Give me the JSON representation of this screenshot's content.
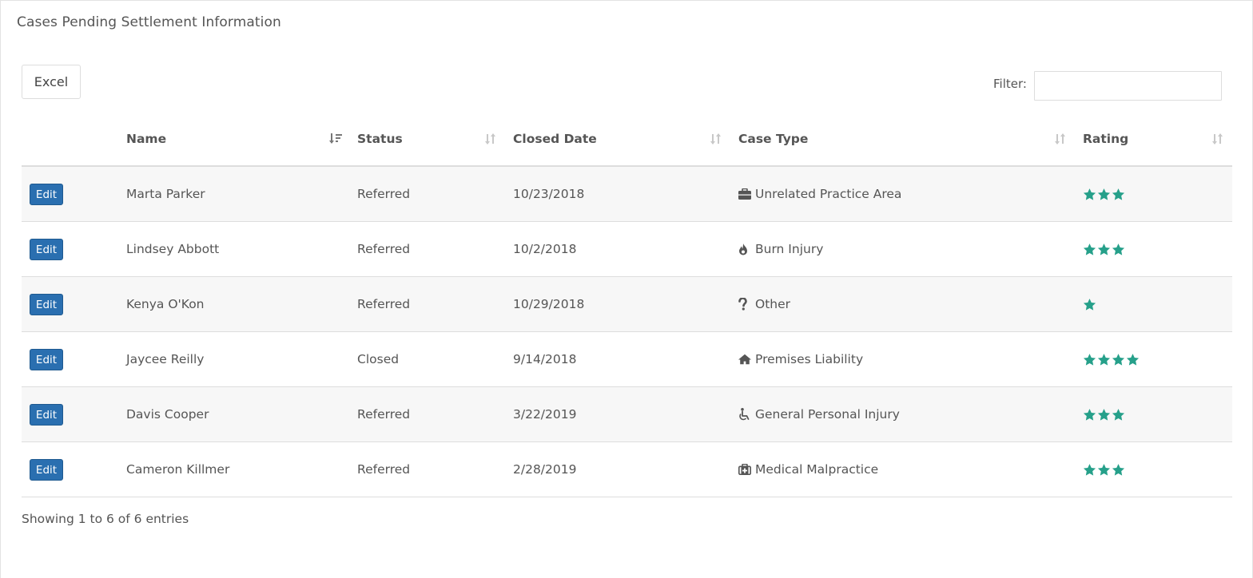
{
  "panel": {
    "title": "Cases Pending Settlement Information"
  },
  "toolbar": {
    "excel_label": "Excel",
    "filter_label": "Filter:",
    "filter_value": ""
  },
  "table": {
    "columns": [
      {
        "key": "name",
        "label": "Name",
        "sort": "desc"
      },
      {
        "key": "status",
        "label": "Status",
        "sort": "none"
      },
      {
        "key": "closed_date",
        "label": "Closed Date",
        "sort": "none"
      },
      {
        "key": "case_type",
        "label": "Case Type",
        "sort": "none"
      },
      {
        "key": "rating",
        "label": "Rating",
        "sort": "none"
      }
    ],
    "edit_label": "Edit",
    "rows": [
      {
        "name": "Marta Parker",
        "status": "Referred",
        "closed_date": "10/23/2018",
        "case_type": "Unrelated Practice Area",
        "case_icon": "briefcase-icon",
        "rating": 3
      },
      {
        "name": "Lindsey Abbott",
        "status": "Referred",
        "closed_date": "10/2/2018",
        "case_type": "Burn Injury",
        "case_icon": "fire-icon",
        "rating": 3
      },
      {
        "name": "Kenya O'Kon",
        "status": "Referred",
        "closed_date": "10/29/2018",
        "case_type": "Other",
        "case_icon": "question-icon",
        "rating": 1
      },
      {
        "name": "Jaycee Reilly",
        "status": "Closed",
        "closed_date": "9/14/2018",
        "case_type": "Premises Liability",
        "case_icon": "home-icon",
        "rating": 4
      },
      {
        "name": "Davis Cooper",
        "status": "Referred",
        "closed_date": "3/22/2019",
        "case_type": "General Personal Injury",
        "case_icon": "wheelchair-icon",
        "rating": 3
      },
      {
        "name": "Cameron Killmer",
        "status": "Referred",
        "closed_date": "2/28/2019",
        "case_type": "Medical Malpractice",
        "case_icon": "medkit-icon",
        "rating": 3
      }
    ]
  },
  "footer": {
    "info": "Showing 1 to 6 of 6 entries"
  },
  "colors": {
    "edit_button": "#2a6fb0",
    "star": "#26a08a",
    "sort_inactive": "#c8c8c8",
    "sort_active": "#777777"
  }
}
